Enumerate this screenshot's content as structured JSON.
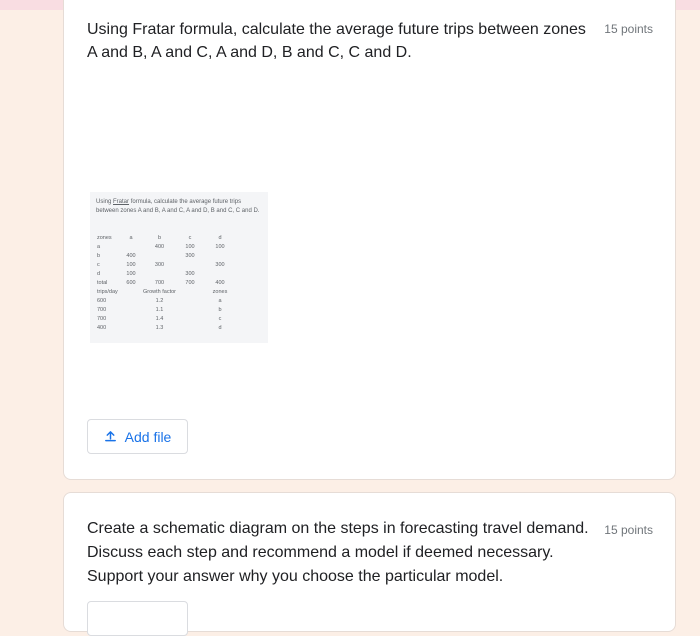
{
  "question1": {
    "text": "Using Fratar formula, calculate the average future trips between zones A and B, A and C, A and D, B and C, C and D.",
    "points": "15 points",
    "image": {
      "title_pre": "Using ",
      "title_link": "Fratar",
      "title_post": " formula, calculate the average future trips between zones A and B, A and C, A and D, B and C, C and D.",
      "rows": [
        [
          "zones",
          "a",
          "b",
          "c",
          "d"
        ],
        [
          "a",
          "",
          "400",
          "100",
          "100"
        ],
        [
          "b",
          "400",
          "",
          "300",
          ""
        ],
        [
          "c",
          "100",
          "300",
          "",
          "300"
        ],
        [
          "d",
          "100",
          "",
          "300",
          ""
        ],
        [
          "total",
          "600",
          "700",
          "700",
          "400"
        ],
        [
          "trips/day",
          "",
          "Growth factor",
          "",
          "zones"
        ],
        [
          "600",
          "",
          "1.2",
          "",
          "a"
        ],
        [
          "700",
          "",
          "1.1",
          "",
          "b"
        ],
        [
          "700",
          "",
          "1.4",
          "",
          "c"
        ],
        [
          "400",
          "",
          "1.3",
          "",
          "d"
        ]
      ]
    },
    "add_file_label": "Add file"
  },
  "question2": {
    "text": "Create a schematic diagram on the steps in forecasting travel demand. Discuss each step and recommend a model if deemed necessary. Support your answer why you choose the particular model.",
    "points": "15 points"
  },
  "colors": {
    "accent": "#1a73e8",
    "page_bg": "#fcefe6",
    "card_bg": "#ffffff"
  },
  "icons": {
    "add_file": "upload-icon"
  }
}
